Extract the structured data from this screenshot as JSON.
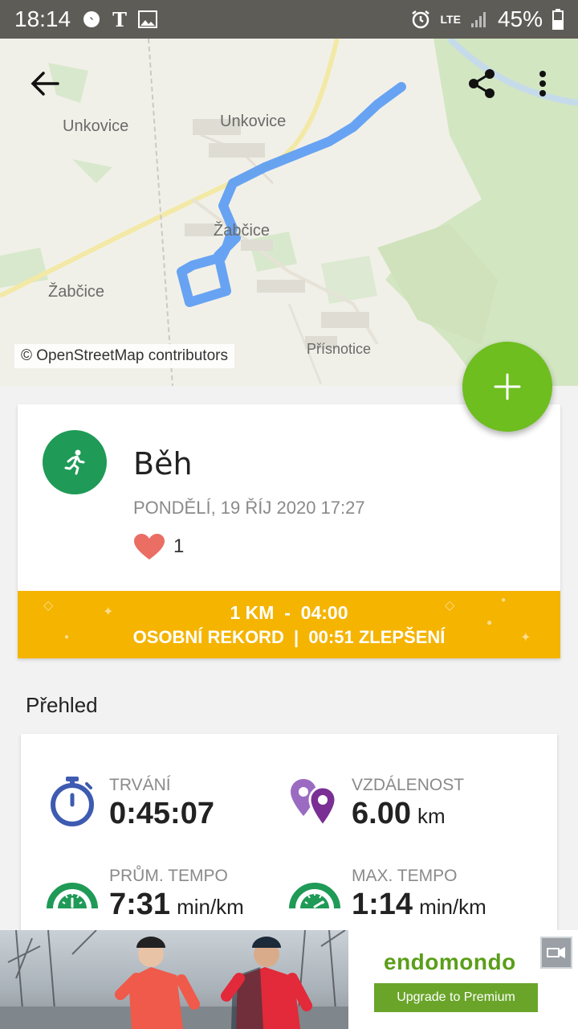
{
  "status_bar": {
    "time": "18:14",
    "network": "LTE",
    "battery": "45%"
  },
  "map": {
    "labels": {
      "unkovice_1": "Unkovice",
      "unkovice_2": "Unkovice",
      "zabcice_1": "Žabčice",
      "zabcice_2": "Žabčice",
      "prisnotice": "Přísnotice"
    },
    "attribution": "© OpenStreetMap contributors",
    "route_color": "#5b9cf2"
  },
  "activity": {
    "sport": "Běh",
    "date": "PONDĚLÍ, 19 ŘÍJ 2020 17:27",
    "likes": "1",
    "record_line1": "1 KM  -  04:00",
    "record_line2": "OSOBNÍ REKORD  |  00:51 ZLEPŠENÍ"
  },
  "overview": {
    "title": "Přehled",
    "duration": {
      "label": "TRVÁNÍ",
      "value": "0:45:07",
      "unit": ""
    },
    "distance": {
      "label": "VZDÁLENOST",
      "value": "6.00",
      "unit": "km"
    },
    "avg_pace": {
      "label": "PRŮM. TEMPO",
      "value": "7:31",
      "unit": "min/km"
    },
    "max_pace": {
      "label": "MAX. TEMPO",
      "value": "1:14",
      "unit": "min/km"
    }
  },
  "ad": {
    "brand": "endomondo",
    "button": "Upgrade to Premium"
  },
  "colors": {
    "fab": "#6dbe1e",
    "sport_circle": "#1f9a57",
    "record_banner": "#f5b400"
  }
}
